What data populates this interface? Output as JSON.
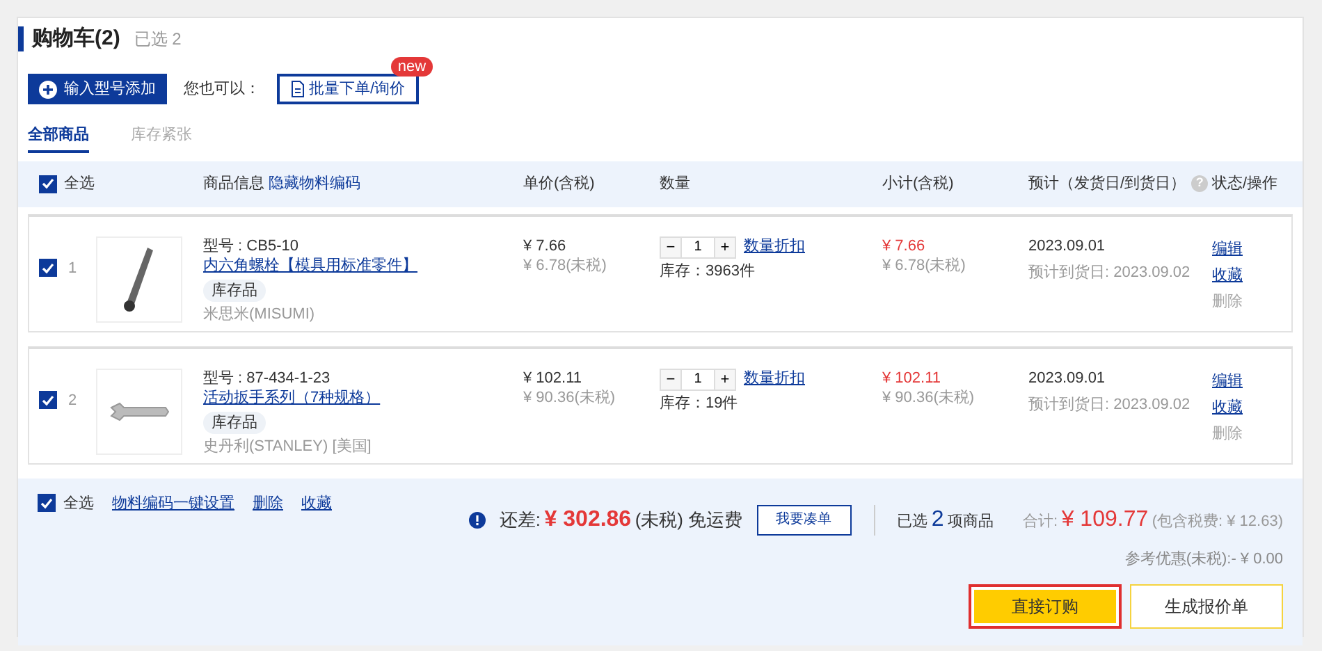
{
  "header": {
    "title": "购物车(2)",
    "selected_count": "已选 2"
  },
  "actions": {
    "add_button": "输入型号添加",
    "also_label": "您也可以：",
    "bulk_button": "批量下单/询价",
    "bulk_badge": "new"
  },
  "tabs": [
    {
      "label": "全部商品",
      "selected": true
    },
    {
      "label": "库存紧张",
      "selected": false
    }
  ],
  "table": {
    "select_all": {
      "label": "全选",
      "checked": true
    },
    "info_column": "商品信息",
    "hide_code_link": "隐藏物料编码",
    "columns": [
      "单价(含税)",
      "数量",
      "小计(含税)",
      "预计（发货日/到货日）",
      "状态/操作"
    ],
    "help_glyph": "?"
  },
  "items": [
    {
      "checked": true,
      "index": "1",
      "model": "型号 : CB5-10",
      "name": "内六角螺栓【模具用标准零件】",
      "tag": "库存品",
      "brand": "米思米(MISUMI)",
      "unit_price": "¥ 7.66",
      "unit_price_net": "¥ 6.78(未税)",
      "minus": "−",
      "quantity": "1",
      "plus": "+",
      "discount_link": "数量折扣",
      "stock": "库存：3963件",
      "subtotal": "¥ 7.66",
      "subtotal_net": "¥ 6.78(未税)",
      "ship_date": "2023.09.01",
      "arrival": "预计到货日: 2023.09.02",
      "actions": [
        {
          "label": "编辑",
          "disabled": false
        },
        {
          "label": "收藏",
          "disabled": false
        },
        {
          "label": "删除",
          "disabled": true
        }
      ]
    },
    {
      "checked": true,
      "index": "2",
      "model": "型号 : 87-434-1-23",
      "name": "活动扳手系列（7种规格）",
      "tag": "库存品",
      "brand": "史丹利(STANLEY) [美国]",
      "unit_price": "¥ 102.11",
      "unit_price_net": "¥ 90.36(未税)",
      "minus": "−",
      "quantity": "1",
      "plus": "+",
      "discount_link": "数量折扣",
      "stock": "库存：19件",
      "subtotal": "¥ 102.11",
      "subtotal_net": "¥ 90.36(未税)",
      "ship_date": "2023.09.01",
      "arrival": "预计到货日: 2023.09.02",
      "actions": [
        {
          "label": "编辑",
          "disabled": false
        },
        {
          "label": "收藏",
          "disabled": false
        },
        {
          "label": "删除",
          "disabled": true
        }
      ]
    }
  ],
  "footer": {
    "select_all": {
      "label": "全选",
      "checked": true
    },
    "links": [
      "物料编码一键设置",
      "删除",
      "收藏"
    ],
    "shortfall_label": "还差:",
    "shortfall_amount": "¥ 302.86",
    "shortfall_note": "(未税) 免运费",
    "topup_button": "我要凑单",
    "selected_prefix": "已选",
    "selected_count": "2",
    "selected_suffix": "项商品",
    "total_label": "合计:",
    "total_amount": "¥ 109.77",
    "total_tax_note": "(包含税费: ¥ 12.63)",
    "discount_note": "参考优惠(未税):- ¥ 0.00",
    "buttons": [
      {
        "label": "直接订购",
        "kind": "primary",
        "highlighted": true
      },
      {
        "label": "生成报价单",
        "kind": "outline",
        "highlighted": false
      }
    ]
  }
}
